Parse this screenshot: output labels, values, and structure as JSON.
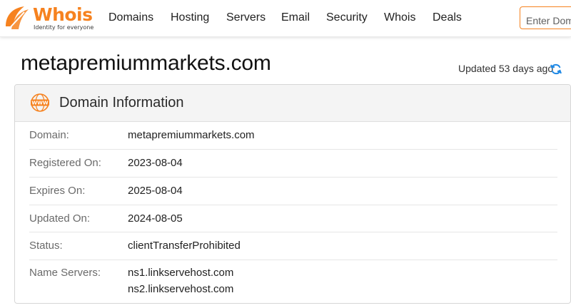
{
  "brand": {
    "name": "Whois",
    "tagline": "Identity for everyone",
    "accent_color": "#f6821f"
  },
  "nav": {
    "items": [
      {
        "label": "Domains"
      },
      {
        "label": "Hosting"
      },
      {
        "label": "Servers"
      },
      {
        "label": "Email"
      },
      {
        "label": "Security"
      },
      {
        "label": "Whois"
      },
      {
        "label": "Deals"
      }
    ]
  },
  "search": {
    "placeholder": "Enter Domain or IP"
  },
  "page": {
    "title": "metapremiummarkets.com",
    "updated_text": "Updated 53 days ago",
    "refresh_icon": "refresh-icon"
  },
  "card": {
    "title": "Domain Information",
    "icon": "www-icon",
    "rows": [
      {
        "label": "Domain:",
        "value": "metapremiummarkets.com"
      },
      {
        "label": "Registered On:",
        "value": "2023-08-04"
      },
      {
        "label": "Expires On:",
        "value": "2025-08-04"
      },
      {
        "label": "Updated On:",
        "value": "2024-08-05"
      },
      {
        "label": "Status:",
        "value": "clientTransferProhibited"
      },
      {
        "label": "Name Servers:",
        "values": [
          "ns1.linkservehost.com",
          "ns2.linkservehost.com"
        ]
      }
    ]
  }
}
